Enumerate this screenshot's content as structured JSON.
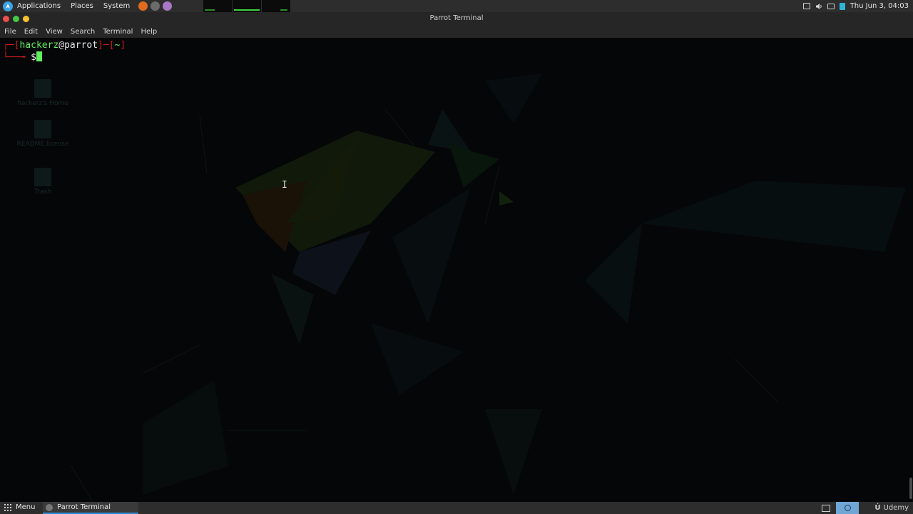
{
  "top_panel": {
    "menus": [
      "Applications",
      "Places",
      "System"
    ],
    "launchers": [
      "firefox-icon",
      "terminal-icon",
      "text-editor-icon"
    ],
    "clock": "Thu Jun  3, 04:03"
  },
  "window": {
    "title": "Parrot Terminal",
    "menu": [
      "File",
      "Edit",
      "View",
      "Search",
      "Terminal",
      "Help"
    ]
  },
  "terminal": {
    "prompt_user": "hackerz",
    "prompt_at": "@",
    "prompt_host": "parrot",
    "prompt_dir": "~",
    "prompt_symbol": "$",
    "colors": {
      "frame": "#d41b1b",
      "user": "#5ef05e",
      "symbol": "#e6e6e6"
    }
  },
  "desktop_icons": [
    "hackerz's Home",
    "README.license",
    "Trash"
  ],
  "bottom_panel": {
    "menu_label": "Menu",
    "task_label": "Parrot Terminal",
    "watermark": "Udemy"
  }
}
